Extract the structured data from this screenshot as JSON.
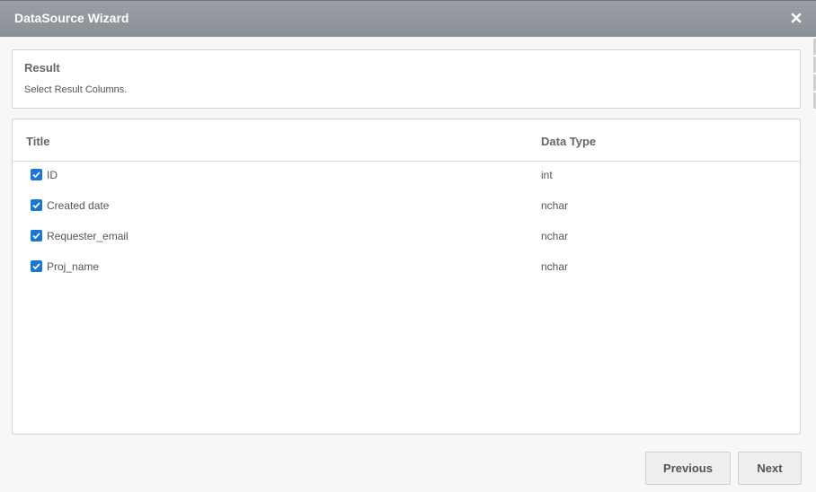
{
  "dialog": {
    "title": "DataSource Wizard",
    "close_icon": "close-icon"
  },
  "step": {
    "heading": "Result",
    "description": "Select Result Columns."
  },
  "table": {
    "columns": [
      "Title",
      "Data Type"
    ],
    "rows": [
      {
        "title": "ID",
        "type": "int",
        "checked": true
      },
      {
        "title": "Created date",
        "type": "nchar",
        "checked": true
      },
      {
        "title": "Requester_email",
        "type": "nchar",
        "checked": true
      },
      {
        "title": "Proj_name",
        "type": "nchar",
        "checked": true
      }
    ]
  },
  "footer": {
    "previous_label": "Previous",
    "next_label": "Next"
  },
  "colors": {
    "titlebar": "#8b9096",
    "checkbox": "#1976d2"
  }
}
